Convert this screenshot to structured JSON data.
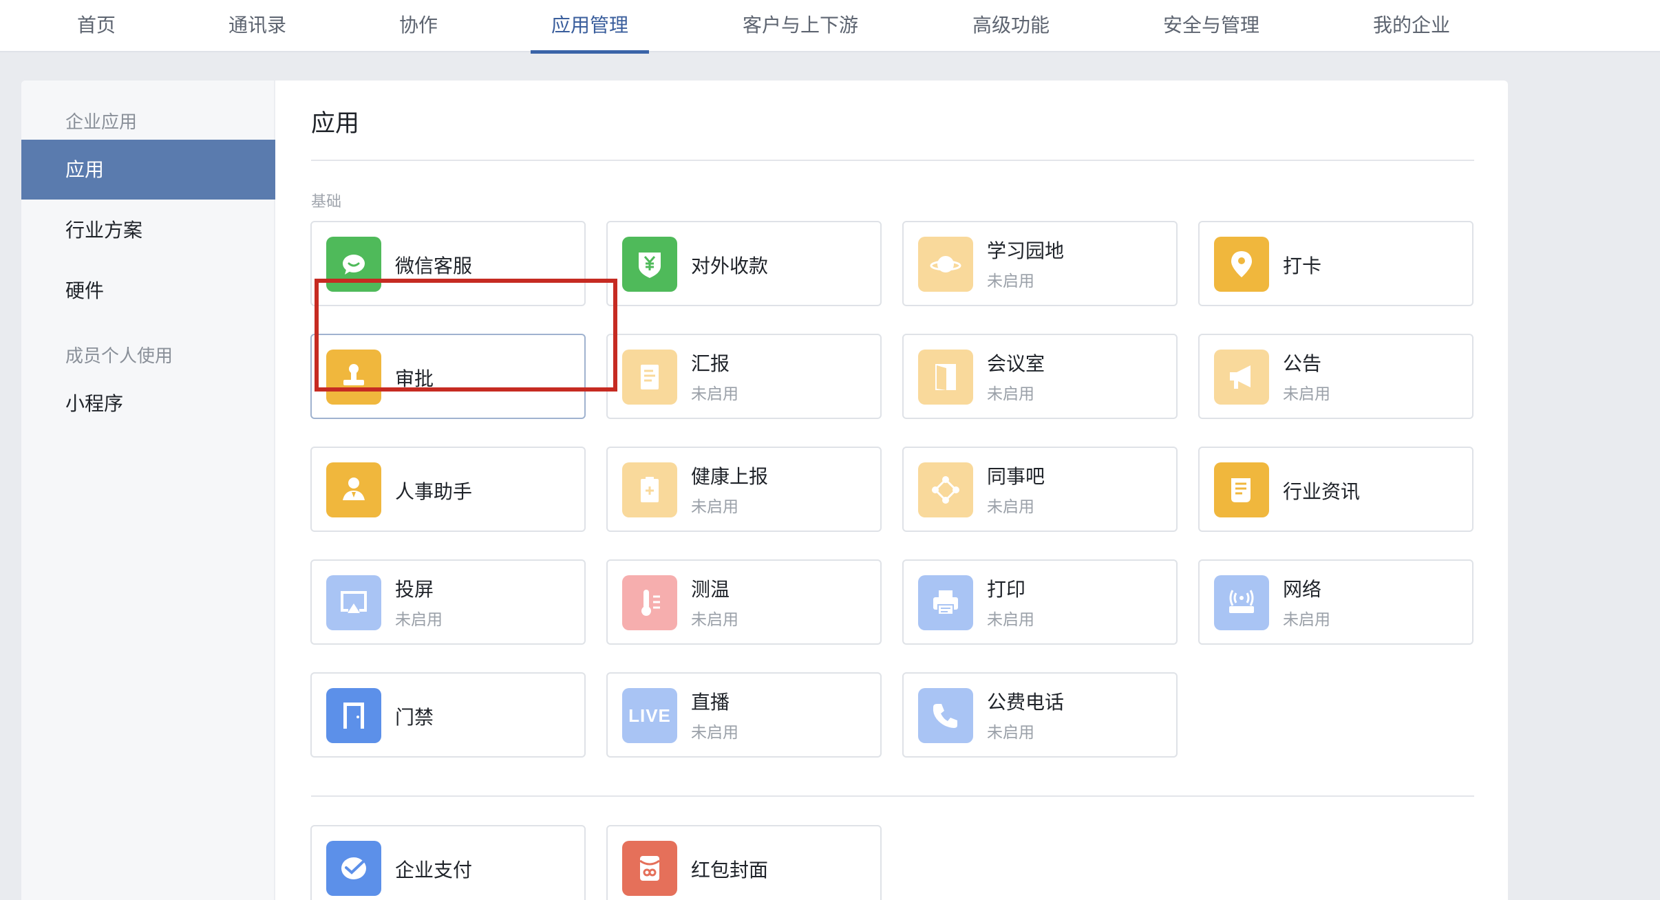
{
  "nav": {
    "tabs": [
      "首页",
      "通讯录",
      "协作",
      "应用管理",
      "客户与上下游",
      "高级功能",
      "安全与管理",
      "我的企业"
    ],
    "active": "应用管理"
  },
  "sidebar": {
    "group1": "企业应用",
    "items1": [
      "应用",
      "行业方案",
      "硬件"
    ],
    "group2": "成员个人使用",
    "items2": [
      "小程序"
    ],
    "active": "应用"
  },
  "main": {
    "title": "应用",
    "section_label": "基础",
    "disabled_text": "未启用",
    "apps": [
      {
        "name": "微信客服",
        "status": "",
        "icon": "wechat-service-icon",
        "color": "#4fba5a"
      },
      {
        "name": "对外收款",
        "status": "",
        "icon": "yuan-shield-icon",
        "color": "#4fba5a"
      },
      {
        "name": "学习园地",
        "status": "未启用",
        "icon": "planet-icon",
        "color": "#f9d99b"
      },
      {
        "name": "打卡",
        "status": "",
        "icon": "location-pin-icon",
        "color": "#f0b73d"
      },
      {
        "name": "审批",
        "status": "",
        "icon": "stamp-icon",
        "color": "#f0b73d"
      },
      {
        "name": "汇报",
        "status": "未启用",
        "icon": "report-icon",
        "color": "#f9d99b"
      },
      {
        "name": "会议室",
        "status": "未启用",
        "icon": "door-icon",
        "color": "#f9d99b"
      },
      {
        "name": "公告",
        "status": "未启用",
        "icon": "megaphone-icon",
        "color": "#f9d99b"
      },
      {
        "name": "人事助手",
        "status": "",
        "icon": "person-icon",
        "color": "#f0b73d"
      },
      {
        "name": "健康上报",
        "status": "未启用",
        "icon": "health-clipboard-icon",
        "color": "#f9d99b"
      },
      {
        "name": "同事吧",
        "status": "未启用",
        "icon": "network-nodes-icon",
        "color": "#f9d99b"
      },
      {
        "name": "行业资讯",
        "status": "",
        "icon": "news-icon",
        "color": "#f0b73d"
      },
      {
        "name": "投屏",
        "status": "未启用",
        "icon": "screen-cast-icon",
        "color": "#a9c4f4"
      },
      {
        "name": "测温",
        "status": "未启用",
        "icon": "thermometer-icon",
        "color": "#f6aeae"
      },
      {
        "name": "打印",
        "status": "未启用",
        "icon": "printer-icon",
        "color": "#a9c4f4"
      },
      {
        "name": "网络",
        "status": "未启用",
        "icon": "router-icon",
        "color": "#a9c4f4"
      },
      {
        "name": "门禁",
        "status": "",
        "icon": "access-door-icon",
        "color": "#5c90e9"
      },
      {
        "name": "直播",
        "status": "未启用",
        "icon": "live-icon",
        "color": "#a9c4f4"
      },
      {
        "name": "公费电话",
        "status": "未启用",
        "icon": "phone-icon",
        "color": "#a9c4f4"
      }
    ],
    "apps2": [
      {
        "name": "企业支付",
        "status": "",
        "icon": "payment-icon",
        "color": "#5c90e9"
      },
      {
        "name": "红包封面",
        "status": "",
        "icon": "red-envelope-icon",
        "color": "#e5705a"
      }
    ],
    "live_text": "LIVE"
  },
  "colors": {
    "nav_active": "#3a5e9c",
    "sidebar_active_bg": "#5a7bae",
    "highlight_box": "#c62b22"
  }
}
